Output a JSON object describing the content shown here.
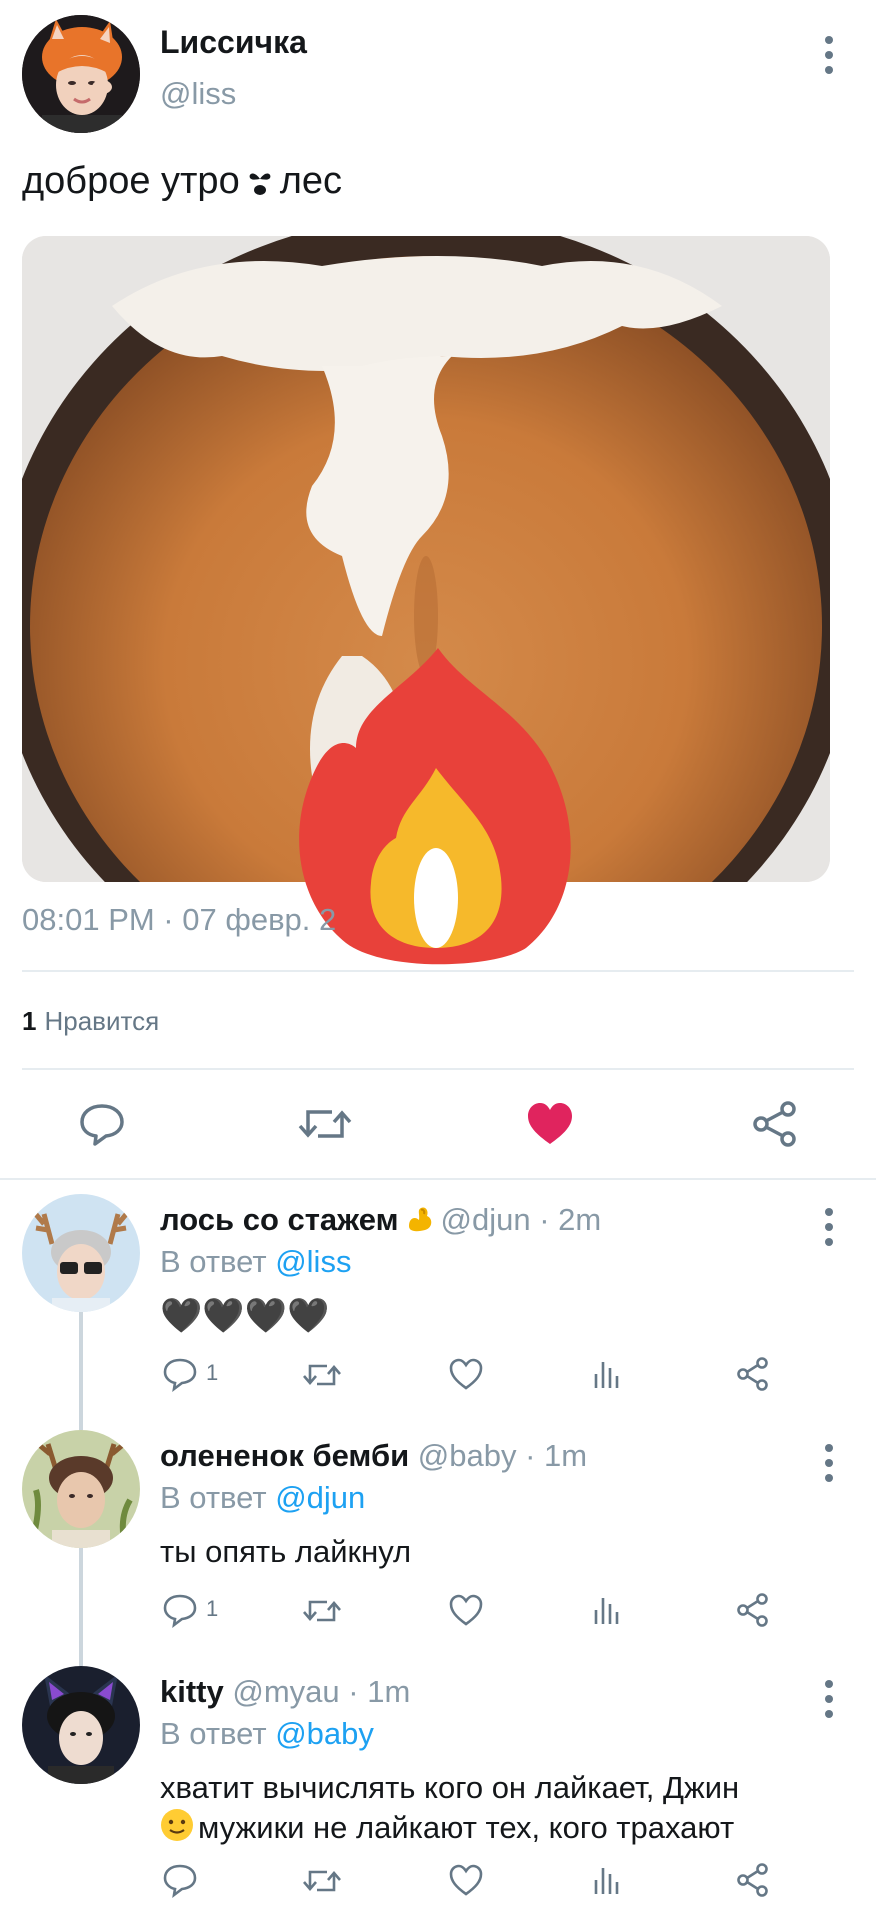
{
  "tweet": {
    "author_name": "Lиссичка",
    "author_handle": "@liss",
    "text_before": "доброе утро",
    "text_after": "лес",
    "inline_icon": "black-heart-exclamation",
    "image": "latte-art-coffee-cup-with-fire-emoji",
    "timestamp": "08:01 PM · 07 февр. 2",
    "likes_count": "1",
    "likes_label": "Нравится",
    "actions": [
      "reply-icon",
      "retweet-icon",
      "like-icon-filled",
      "share-icon"
    ],
    "colors": {
      "like": "#e0245e",
      "link": "#1da1f2",
      "muted": "#8899a6"
    }
  },
  "replies": [
    {
      "name": "лось со стажем",
      "emoji": "flexed-biceps",
      "meta": "@djun · 2m",
      "reply_prefix": "В ответ",
      "reply_to": "@liss",
      "text": "🖤🖤🖤🖤",
      "reply_count": "1"
    },
    {
      "name": "олененок бемби",
      "meta": "@baby · 1m",
      "reply_prefix": "В ответ",
      "reply_to": "@djun",
      "text": "ты опять лайкнул",
      "reply_count": "1"
    },
    {
      "name": "kitty",
      "meta": "@myau · 1m",
      "reply_prefix": "В ответ",
      "reply_to": "@baby",
      "text_line1": "хватит вычислять кого он лайкает,  Джин",
      "text_line2": "мужики не лайкают тех, кого трахают",
      "reply_count": ""
    }
  ]
}
